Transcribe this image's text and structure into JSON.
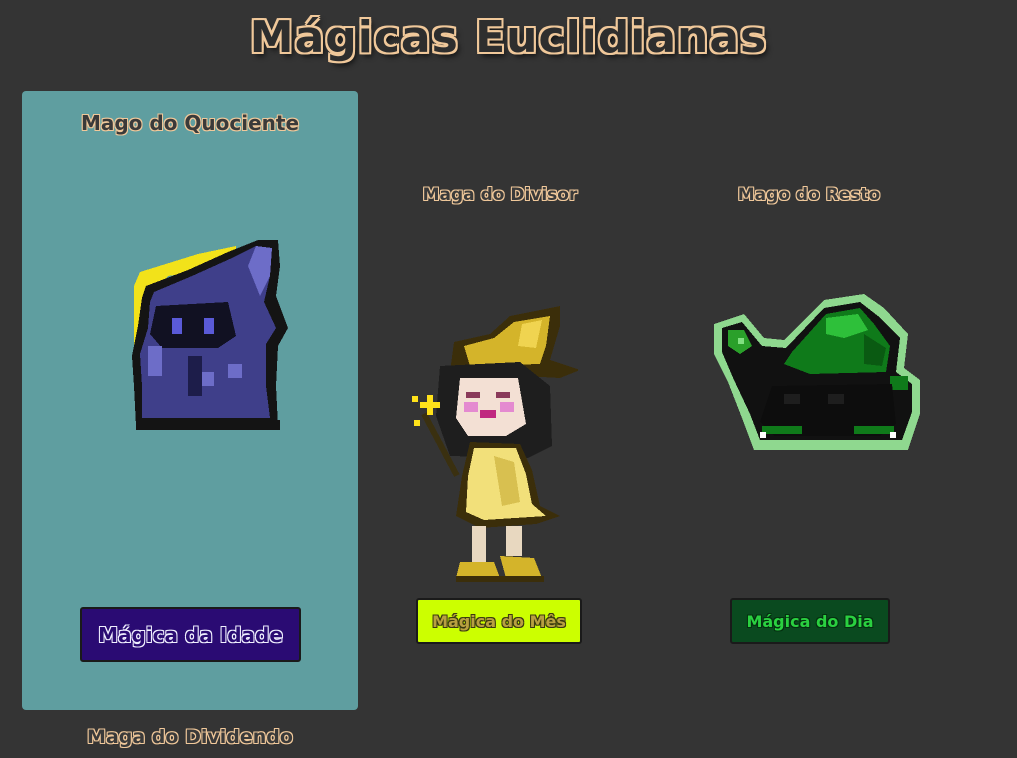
{
  "title": "Mágicas Euclidianas",
  "characters": {
    "quociente": {
      "name": "Mago do Quociente",
      "button": "Mágica da Idade",
      "button_color": "#2a0b73"
    },
    "divisor": {
      "name": "Maga do Divisor",
      "button": "Mágica do Mês",
      "button_color": "#ccff00"
    },
    "resto": {
      "name": "Mago do Resto",
      "button": "Mágica do Dia",
      "button_color": "#0a4a1f"
    }
  },
  "footer_label": "Maga do Dividendo",
  "colors": {
    "background": "#343434",
    "card": "#5f9ea0",
    "label_outline": "#f0c89a"
  }
}
